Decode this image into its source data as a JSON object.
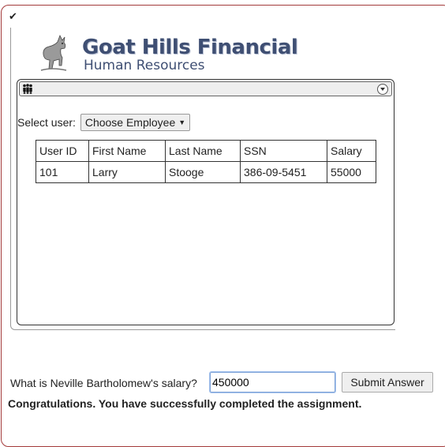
{
  "app": {
    "brand_title": "Goat Hills Financial",
    "brand_subtitle": "Human Resources"
  },
  "select": {
    "label": "Select user:",
    "selected": "Choose Employee"
  },
  "table": {
    "headers": [
      "User ID",
      "First Name",
      "Last Name",
      "SSN",
      "Salary"
    ],
    "rows": [
      [
        "101",
        "Larry",
        "Stooge",
        "386-09-5451",
        "55000"
      ]
    ]
  },
  "form": {
    "question": "What is Neville Bartholomew's salary?",
    "answer_value": "450000",
    "submit_label": "Submit Answer"
  },
  "result": {
    "message": "Congratulations. You have successfully completed the assignment."
  },
  "icons": {
    "status": "check-icon",
    "logo": "goat-icon",
    "panel": "people-icon",
    "toggle": "collapse-icon"
  },
  "colors": {
    "frame_border": "#a33a3a",
    "brand": "#3f4f73"
  }
}
